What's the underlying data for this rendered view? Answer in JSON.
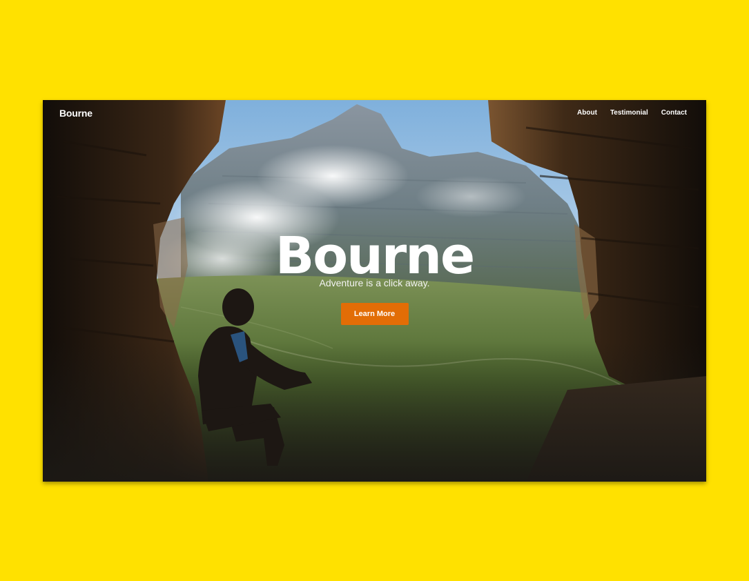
{
  "nav": {
    "brand": "Bourne",
    "links": [
      "About",
      "Testimonial",
      "Contact"
    ]
  },
  "hero": {
    "title": "Bourne",
    "subtitle": "Adventure is a click away.",
    "cta_label": "Learn More"
  },
  "colors": {
    "page_background": "#FFE100",
    "cta_background": "#E26D06",
    "text": "#FFFFFF"
  }
}
